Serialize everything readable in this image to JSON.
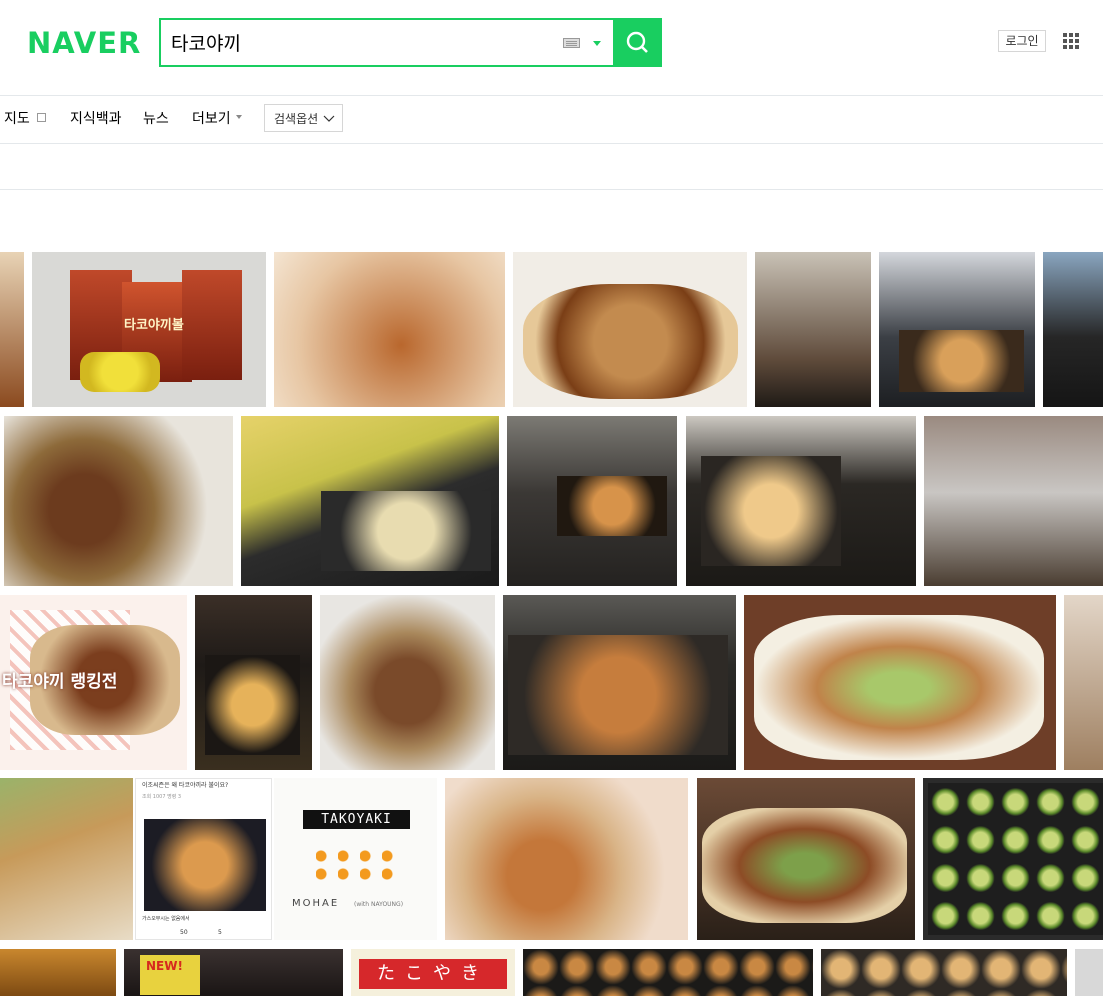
{
  "header": {
    "logo": "NAVER",
    "search_value": "타코야끼",
    "login_label": "로그인"
  },
  "tabs": {
    "map": "지도",
    "dictionary": "지식백과",
    "news": "뉴스",
    "more": "더보기",
    "options": "검색옵션"
  },
  "thumbnails": {
    "snack_package_text": "타코야끼볼",
    "ranking_text": "타코야끼 랭킹전",
    "blog_title": "이조씨즌은 왜 타코야끼라 불이요?",
    "blog_meta": "조회 1007 명령 3",
    "blog_caption": "가스오부시는 없음에서",
    "blog_like_count": "50",
    "blog_comment_count": "5",
    "takoyaki_brand": "TAKOYAKI",
    "mohae_text": "MOHAE",
    "mohae_sub": "(with NAYOUNG)",
    "kana_sign": "たこやき",
    "neon_sign": "NEW!"
  },
  "colors": {
    "brand_green": "#19ce60"
  }
}
